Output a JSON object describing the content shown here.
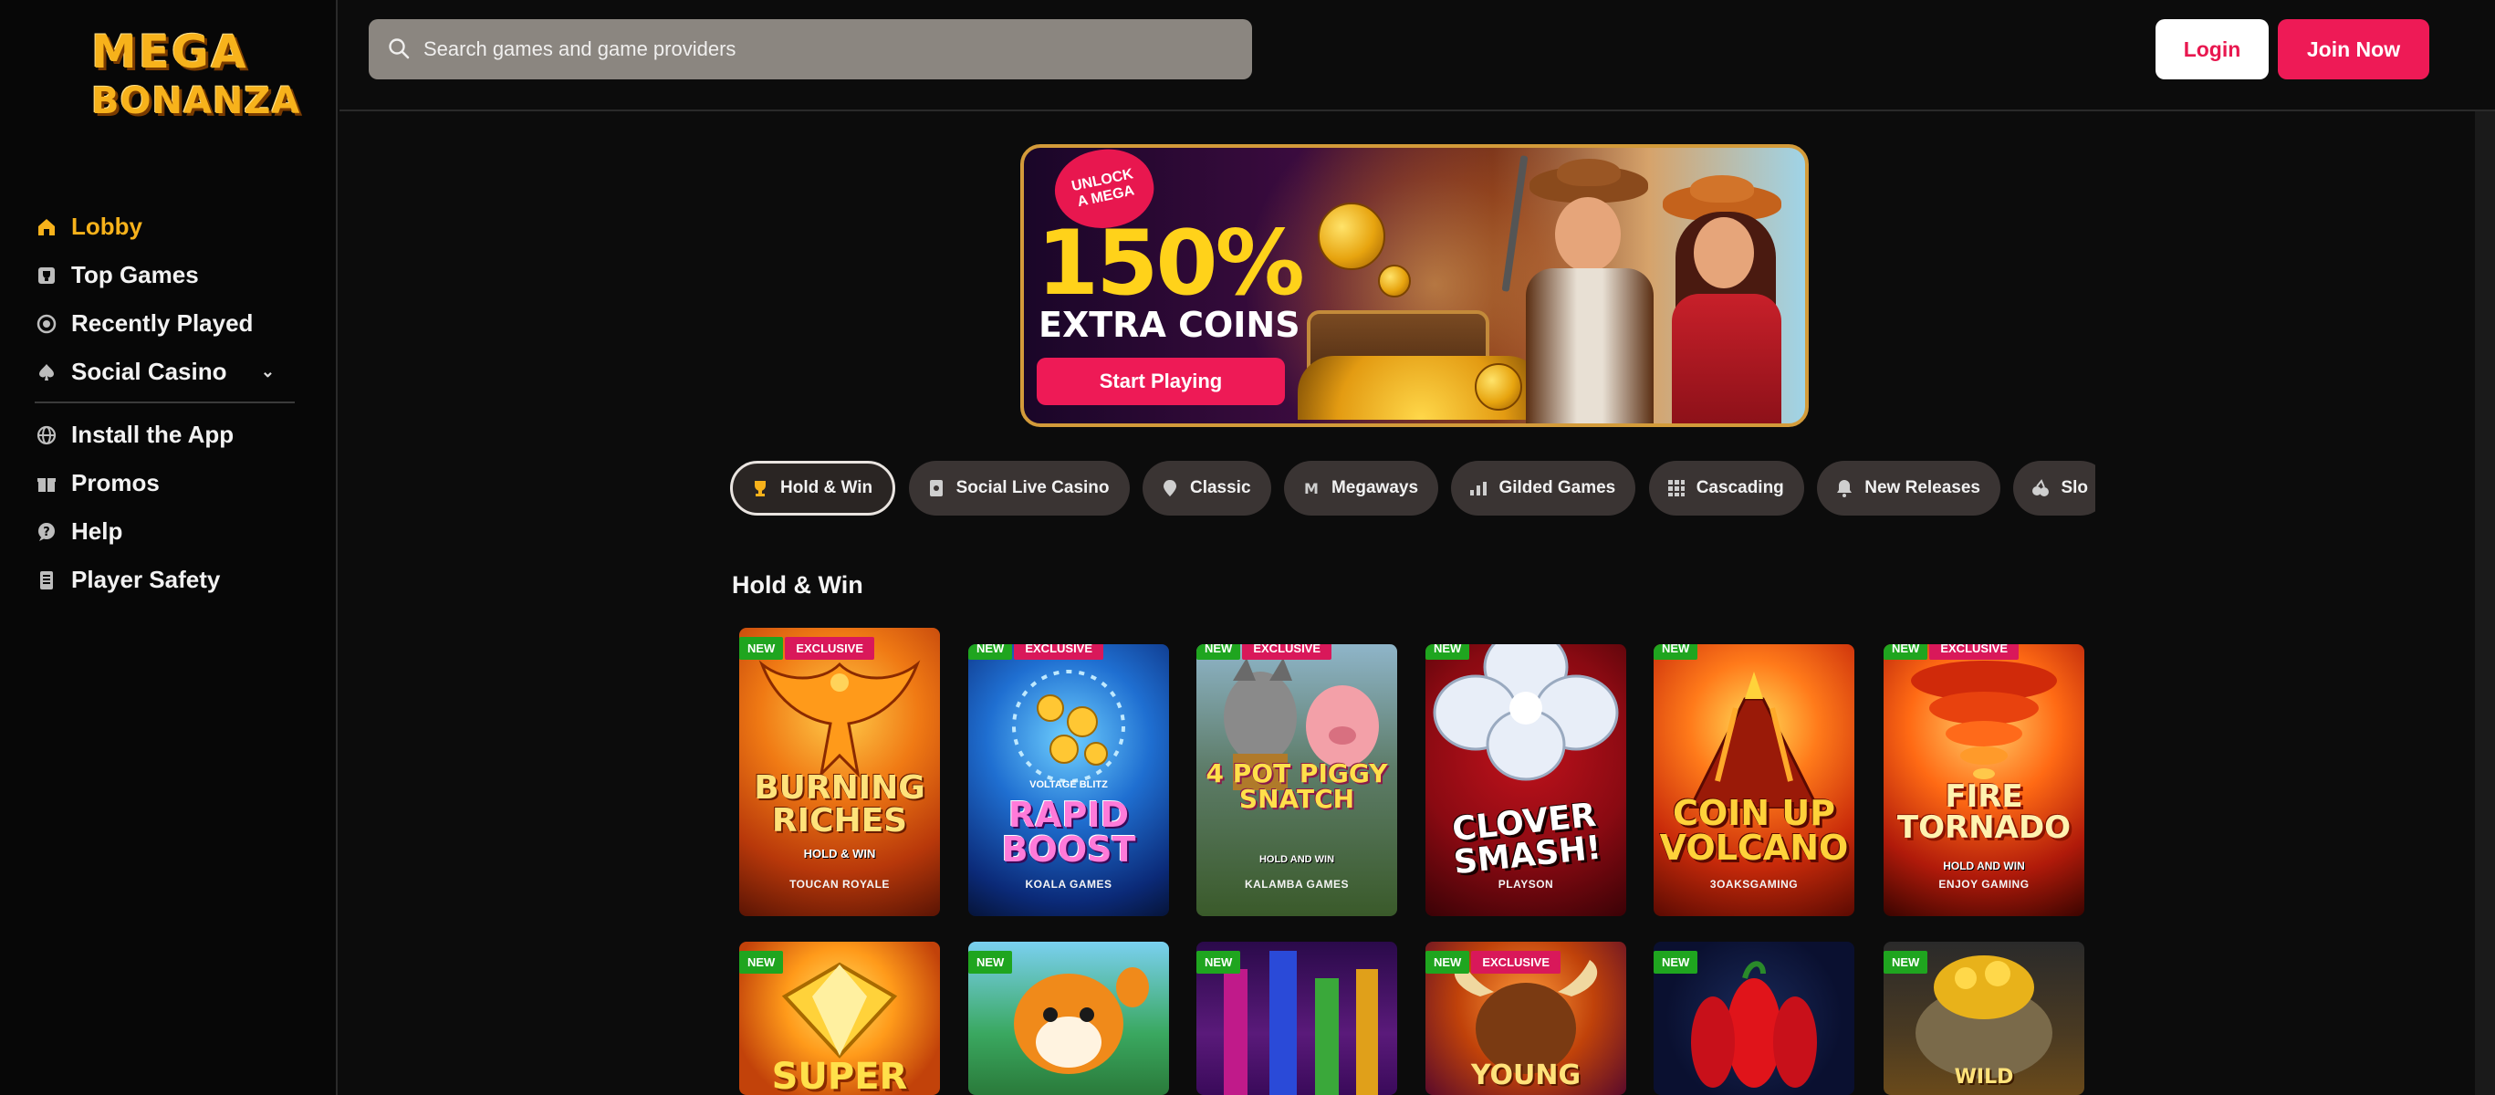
{
  "app": {
    "logo_line1": "MEGA",
    "logo_line2": "BONANZA"
  },
  "sidebar": {
    "items": [
      {
        "label": "Lobby",
        "icon": "home-icon",
        "active": true
      },
      {
        "label": "Top Games",
        "icon": "trophy-icon"
      },
      {
        "label": "Recently Played",
        "icon": "history-icon"
      },
      {
        "label": "Social Casino",
        "icon": "spade-icon",
        "expandable": true
      }
    ],
    "secondary_items": [
      {
        "label": "Install the App",
        "icon": "globe-icon"
      },
      {
        "label": "Promos",
        "icon": "gift-icon"
      },
      {
        "label": "Help",
        "icon": "help-icon"
      },
      {
        "label": "Player Safety",
        "icon": "document-icon"
      }
    ]
  },
  "header": {
    "search_placeholder": "Search games and game providers",
    "login_label": "Login",
    "join_label": "Join Now"
  },
  "banner": {
    "badge_line1": "UNLOCK",
    "badge_line2": "A MEGA",
    "headline": "150%",
    "subline": "EXTRA COINS",
    "cta_label": "Start Playing"
  },
  "categories": [
    {
      "label": "Hold & Win",
      "icon": "trophy-icon",
      "active": true
    },
    {
      "label": "Social Live Casino",
      "icon": "cards-icon"
    },
    {
      "label": "Classic",
      "icon": "diamond-icon"
    },
    {
      "label": "Megaways",
      "icon": "megaways-icon"
    },
    {
      "label": "Gilded Games",
      "icon": "chart-icon"
    },
    {
      "label": "Cascading",
      "icon": "grid-icon"
    },
    {
      "label": "New Releases",
      "icon": "bell-icon"
    },
    {
      "label": "Slo",
      "icon": "fruit-icon"
    }
  ],
  "section": {
    "title": "Hold & Win"
  },
  "badges": {
    "new": "NEW",
    "exclusive": "EXCLUSIVE"
  },
  "games_row1": [
    {
      "title": "BURNING RICHES",
      "subtitle": "HOLD & WIN",
      "provider": "TOUCAN ROYALE",
      "new": true,
      "exclusive": true
    },
    {
      "title": "RAPID BOOST",
      "subtitle": "VOLTAGE BLITZ",
      "provider": "KOALA GAMES",
      "new": true,
      "exclusive": true
    },
    {
      "title": "4 POT PIGGY SNATCH",
      "subtitle": "HOLD AND WIN",
      "provider": "KALAMBA GAMES",
      "new": true,
      "exclusive": true
    },
    {
      "title": "CLOVER SMASH!",
      "subtitle": "",
      "provider": "PLAYSON",
      "new": true,
      "exclusive": false
    },
    {
      "title": "COIN UP VOLCANO",
      "subtitle": "",
      "provider": "3OAKSGAMING",
      "new": true,
      "exclusive": false
    },
    {
      "title": "FIRE TORNADO",
      "subtitle": "HOLD AND WIN",
      "provider": "ENJOY GAMING",
      "new": true,
      "exclusive": true
    }
  ],
  "games_row2": [
    {
      "title": "SUPER",
      "new": true,
      "exclusive": false
    },
    {
      "title": "",
      "new": true,
      "exclusive": false
    },
    {
      "title": "",
      "new": true,
      "exclusive": false
    },
    {
      "title": "YOUNG",
      "new": true,
      "exclusive": true
    },
    {
      "title": "",
      "new": true,
      "exclusive": false
    },
    {
      "title": "WILD",
      "new": true,
      "exclusive": false
    }
  ],
  "colors": {
    "accent_gold": "#f7b21b",
    "brand_pink": "#ee1a56",
    "new_green": "#1fa51f",
    "exclusive_pink": "#d9185a"
  }
}
